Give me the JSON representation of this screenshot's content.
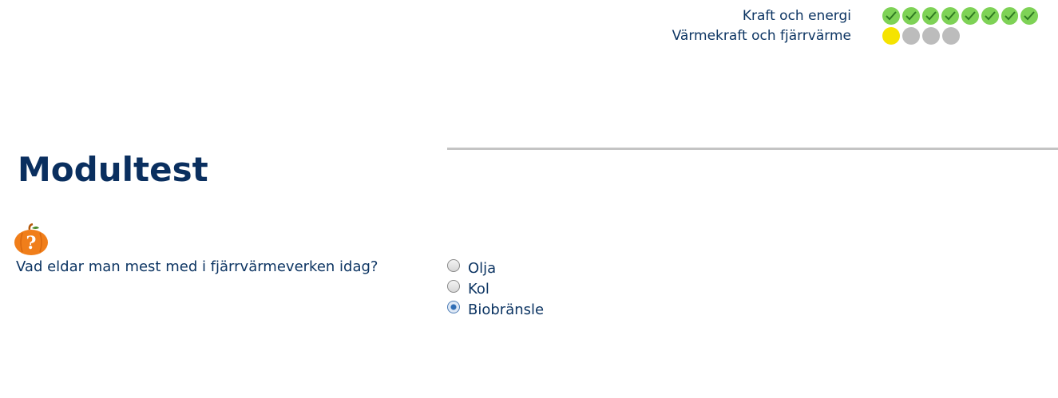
{
  "progress": {
    "rows": [
      {
        "label": "Kraft och energi",
        "dots": [
          "done",
          "done",
          "done",
          "done",
          "done",
          "done",
          "done",
          "done"
        ]
      },
      {
        "label": "Värmekraft och fjärrvärme",
        "dots": [
          "current",
          "todo",
          "todo",
          "todo"
        ]
      }
    ]
  },
  "page": {
    "title": "Modultest"
  },
  "question": {
    "icon": "question-pumpkin-icon",
    "text": "Vad eldar man mest med i fjärrvärmeverken idag?",
    "options": [
      {
        "label": "Olja",
        "selected": false
      },
      {
        "label": "Kol",
        "selected": false
      },
      {
        "label": "Biobränsle",
        "selected": true
      }
    ]
  },
  "colors": {
    "done": "#7ed256",
    "current": "#f5e300",
    "todo": "#bcbcbc",
    "text": "#0d3563",
    "icon_orange": "#f07e1a"
  }
}
